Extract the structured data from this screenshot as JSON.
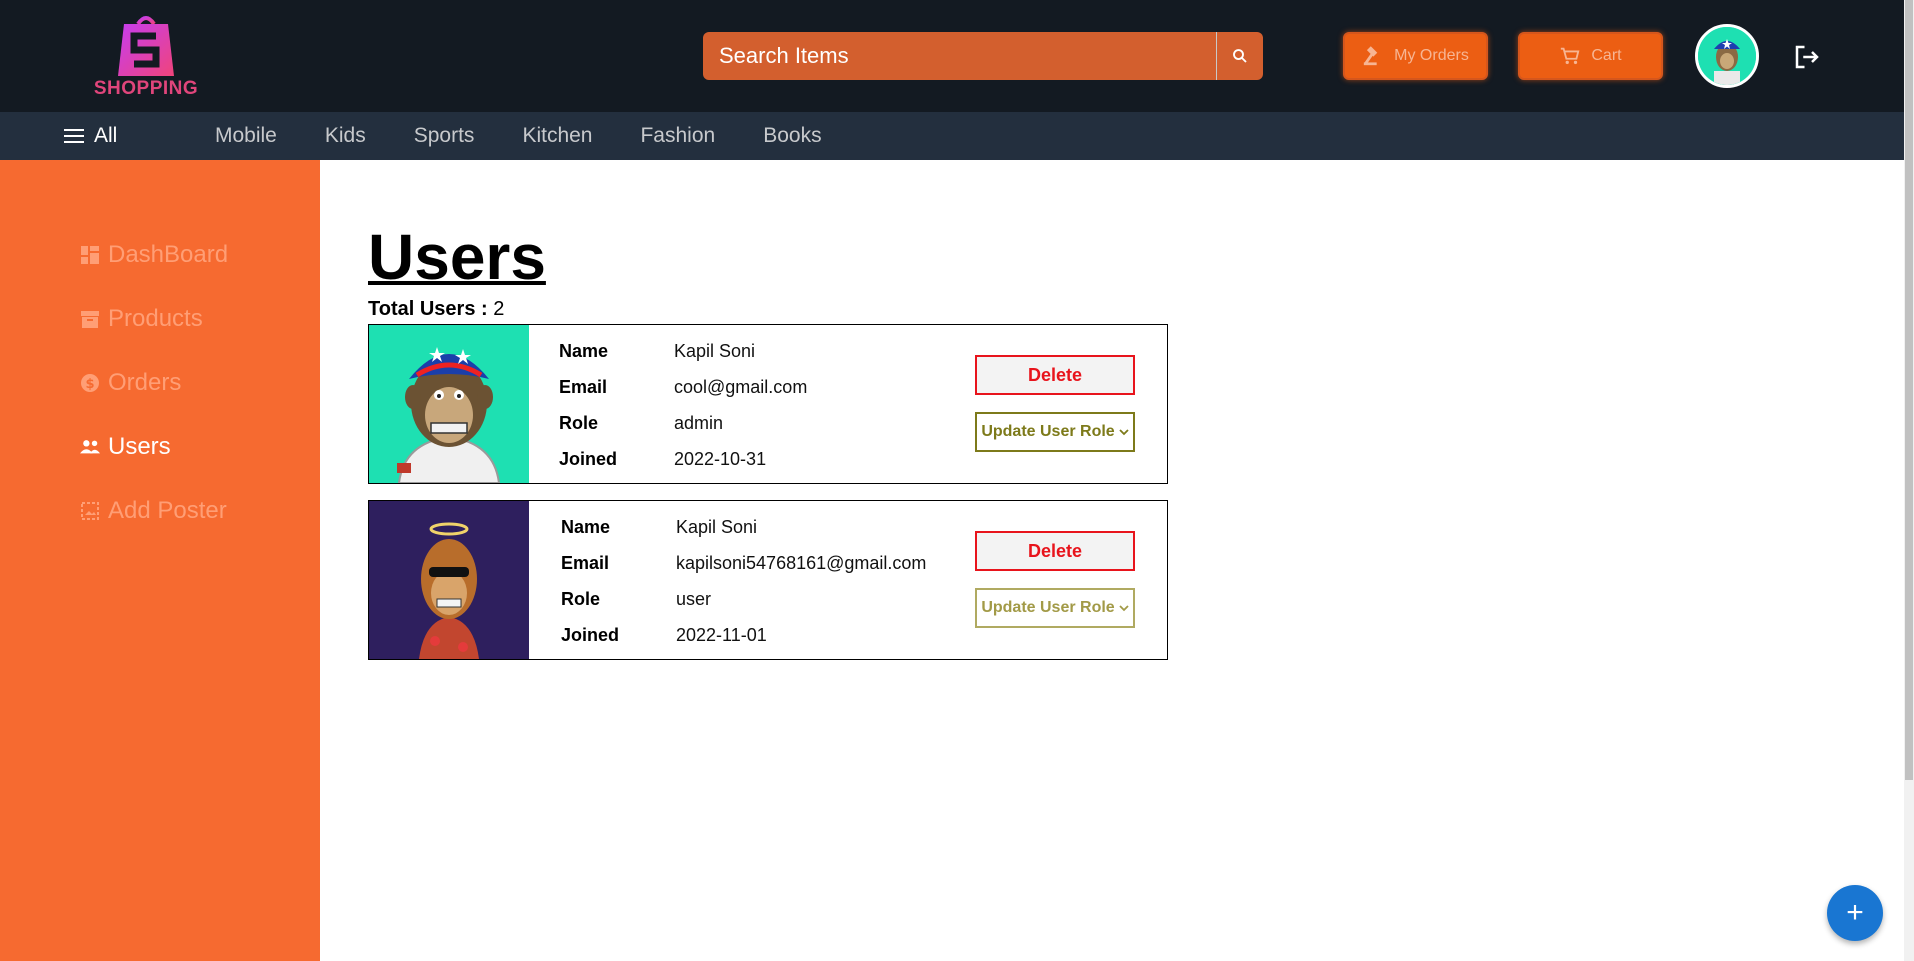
{
  "header": {
    "logo_text": "SHOPPING",
    "search_placeholder": "Search Items",
    "my_orders_label": "My Orders",
    "cart_label": "Cart"
  },
  "nav": {
    "all_label": "All",
    "items": [
      "Mobile",
      "Kids",
      "Sports",
      "Kitchen",
      "Fashion",
      "Books"
    ]
  },
  "sidebar": {
    "items": [
      {
        "label": "DashBoard",
        "icon": "dashboard-icon"
      },
      {
        "label": "Products",
        "icon": "archive-icon"
      },
      {
        "label": "Orders",
        "icon": "dollar-icon"
      },
      {
        "label": "Users",
        "icon": "users-icon"
      },
      {
        "label": "Add Poster",
        "icon": "image-add-icon"
      }
    ]
  },
  "main": {
    "title": "Users",
    "total_label": "Total Users :",
    "total_value": "2",
    "field_labels": {
      "name": "Name",
      "email": "Email",
      "role": "Role",
      "joined": "Joined"
    },
    "delete_label": "Delete",
    "update_role_label": "Update User Role",
    "users": [
      {
        "name": "Kapil Soni",
        "email": "cool@gmail.com",
        "role": "admin",
        "joined": "2022-10-31"
      },
      {
        "name": "Kapil Soni",
        "email": "kapilsoni54768161@gmail.com",
        "role": "user",
        "joined": "2022-11-01"
      }
    ]
  },
  "colors": {
    "header_bg": "#131a22",
    "nav_bg": "#232f3e",
    "sidebar_bg": "#f66a30",
    "accent": "#ec5e13",
    "delete": "#e8141c",
    "fab": "#1976d2"
  },
  "fab_label": "+"
}
